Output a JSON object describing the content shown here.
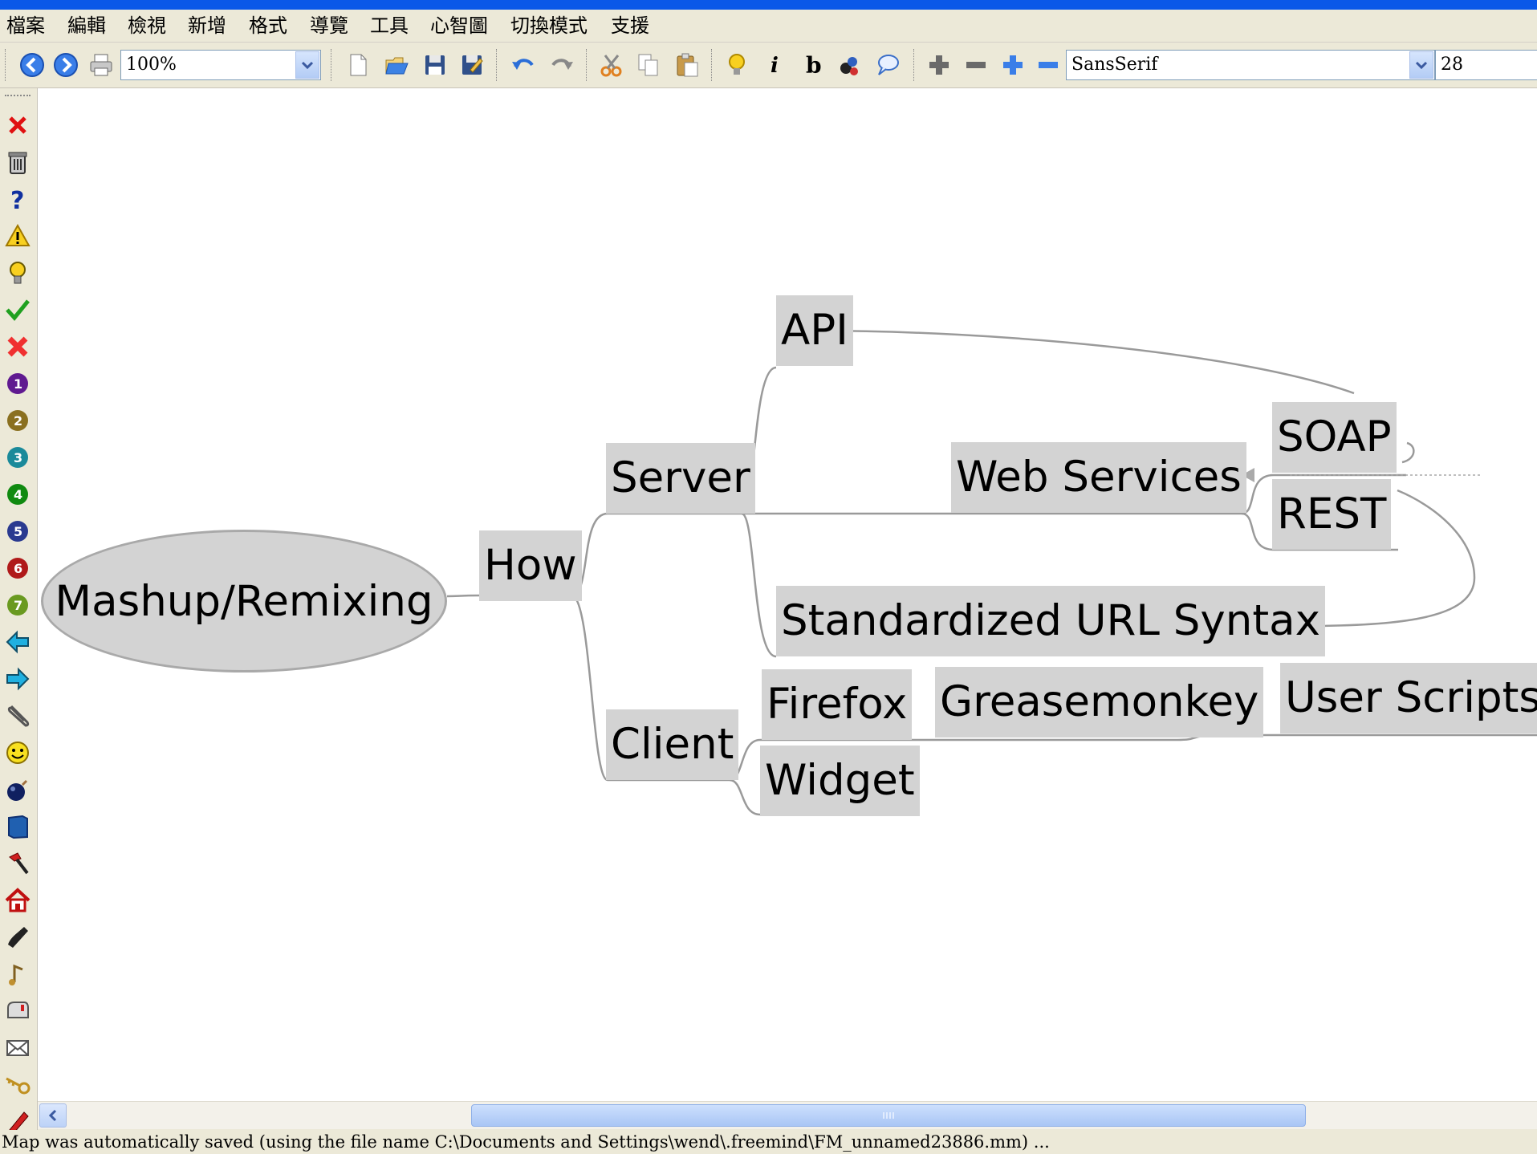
{
  "menu": [
    "檔案",
    "編輯",
    "檢視",
    "新增",
    "格式",
    "導覽",
    "工具",
    "心智圖",
    "切換模式",
    "支援"
  ],
  "toolbar": {
    "zoom_value": "100%",
    "font_family": "SansSerif",
    "font_size": "28",
    "icons": [
      "back-icon",
      "forward-icon",
      "print-icon",
      "new-file-icon",
      "open-icon",
      "save-icon",
      "save-as-icon",
      "undo-icon",
      "redo-icon",
      "cut-icon",
      "copy-icon",
      "paste-icon",
      "idea-bulb-icon",
      "italic-icon",
      "bold-icon",
      "cloud-icon",
      "note-bubble-icon",
      "expand-icon",
      "collapse-icon",
      "zoom-in-icon",
      "zoom-out-icon"
    ]
  },
  "left_icons": [
    "remove-last-icon-icon",
    "remove-all-icons-icon",
    "question-icon",
    "warning-icon",
    "idea-icon",
    "ok-check-icon",
    "not-ok-icon",
    "priority-1-icon",
    "priority-2-icon",
    "priority-3-icon",
    "priority-4-icon",
    "priority-5-icon",
    "priority-6-icon",
    "priority-7-icon",
    "back-arrow-icon",
    "forward-arrow-icon",
    "attachment-icon",
    "smiley-icon",
    "bomb-icon",
    "book-icon",
    "hammer-icon",
    "home-icon",
    "phone-icon",
    "music-icon",
    "mailbox-icon",
    "mail-icon",
    "key-icon",
    "pencil-icon"
  ],
  "accent_colors": {
    "node_fill": "#d3d3d3",
    "edge": "#9a9a9a",
    "canvas": "#ffffff",
    "chrome": "#ece9d8",
    "title": "#0a58e8"
  },
  "mindmap": {
    "root": "Mashup/Remixing",
    "how": "How",
    "server": "Server",
    "client": "Client",
    "api": "API",
    "web_services": "Web Services",
    "soap": "SOAP",
    "rest": "REST",
    "url_syntax": "Standardized URL Syntax",
    "firefox": "Firefox",
    "greasemonkey": "Greasemonkey",
    "user_scripts": "User Scripts",
    "widget": "Widget"
  },
  "status": "Map was automatically saved (using the file name C:\\Documents and Settings\\wend\\.freemind\\FM_unnamed23886.mm) ..."
}
